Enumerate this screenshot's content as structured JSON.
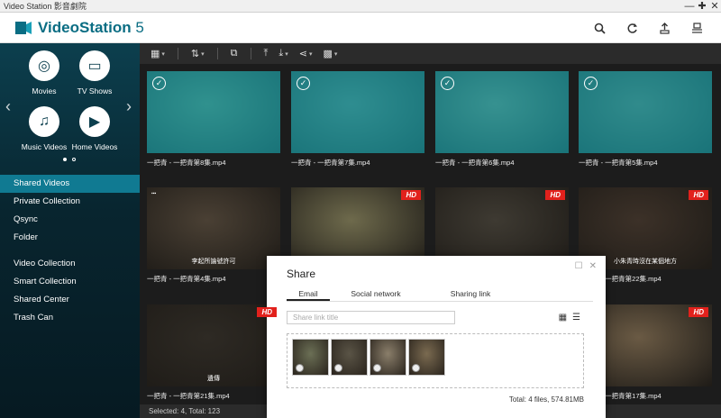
{
  "window": {
    "title": "Video Station 影音劇院",
    "controls": [
      "—",
      "✚",
      "✕"
    ]
  },
  "app": {
    "name": "VideoStation",
    "version": "5",
    "accent": "#0a6d83"
  },
  "header_icons": [
    "search-icon",
    "refresh-icon",
    "upload-icon",
    "settings-icon"
  ],
  "categories": [
    {
      "label": "Movies",
      "icon": "film-reel-icon",
      "glyph": "◎"
    },
    {
      "label": "TV Shows",
      "icon": "tv-icon",
      "glyph": "▭"
    },
    {
      "label": "Music Videos",
      "icon": "music-note-icon",
      "glyph": "♫"
    },
    {
      "label": "Home Videos",
      "icon": "camcorder-icon",
      "glyph": "▶"
    }
  ],
  "nav": {
    "primary": [
      "Shared Videos",
      "Private Collection",
      "Qsync",
      "Folder"
    ],
    "secondary": [
      "Video Collection",
      "Smart Collection",
      "Shared Center",
      "Trash Can"
    ],
    "active": "Shared Videos"
  },
  "toolbar": [
    "grid-view-icon",
    "sort-icon",
    "copy-icon",
    "upload-icon",
    "download-icon",
    "share-icon",
    "qr-code-icon"
  ],
  "videos": [
    {
      "name": "一把青 - 一把青第8集.mp4",
      "selected": true,
      "hd": false,
      "subtitle": "",
      "tone": "#5a6a50"
    },
    {
      "name": "一把青 - 一把青第7集.mp4",
      "selected": true,
      "hd": false,
      "subtitle": "",
      "tone": "#566055"
    },
    {
      "name": "一把青 - 一把青第6集.mp4",
      "selected": true,
      "hd": false,
      "subtitle": "",
      "tone": "#6b6b55"
    },
    {
      "name": "一把青 - 一把青第5集.mp4",
      "selected": true,
      "hd": false,
      "subtitle": "",
      "tone": "#5b5a4a"
    },
    {
      "name": "一把青 - 一把青第4集.mp4",
      "selected": false,
      "hd": false,
      "subtitle": "李起所論號許可",
      "tone": "#4a4034"
    },
    {
      "name": "",
      "selected": false,
      "hd": true,
      "subtitle": "",
      "tone": "#6e6a4c"
    },
    {
      "name": "",
      "selected": false,
      "hd": true,
      "subtitle": "",
      "tone": "#3e3a32"
    },
    {
      "name": "一把青 - 一把青第22集.mp4",
      "selected": false,
      "hd": true,
      "subtitle": "小朱青時沒在某個地方",
      "tone": "#3c3128"
    },
    {
      "name": "一把青 - 一把青第21集.mp4",
      "selected": false,
      "hd": true,
      "subtitle": "遺傳",
      "tone": "#2e2a24"
    },
    {
      "name": "一把青 - 一把青第17集.mp4",
      "selected": false,
      "hd": true,
      "subtitle": "",
      "tone": "#6a5a44"
    }
  ],
  "status": "Selected: 4, Total: 123",
  "share_dialog": {
    "title": "Share",
    "tabs": [
      "Email",
      "Social network",
      "Sharing link"
    ],
    "active_tab": "Email",
    "link_title_placeholder": "Share link title",
    "view_icons": [
      "grid-view-icon",
      "list-view-icon"
    ],
    "thumb_tones": [
      "#6b6f55",
      "#5a5446",
      "#8a7e6a",
      "#7a6a50"
    ],
    "total": "Total: 4 files, 574.81MB"
  }
}
